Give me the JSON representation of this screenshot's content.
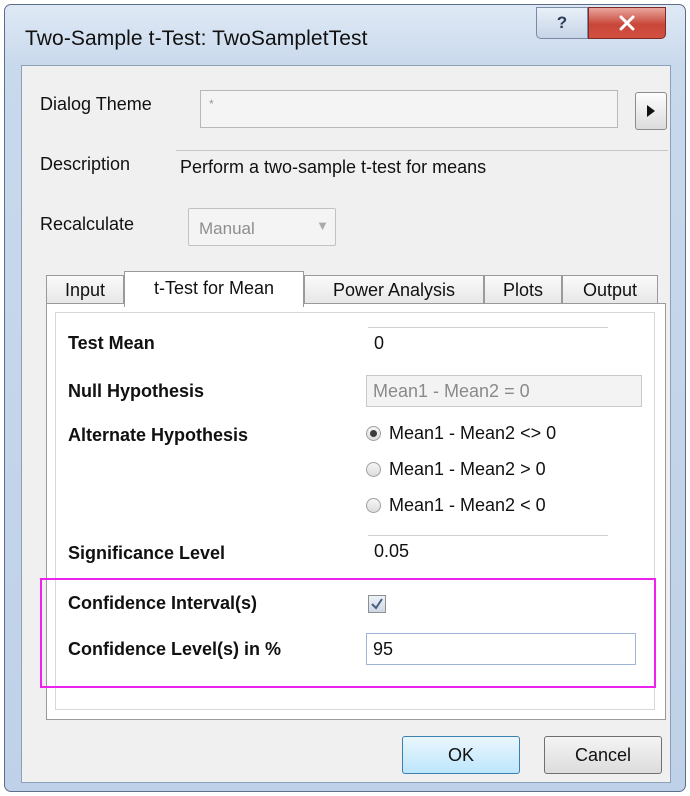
{
  "window": {
    "title": "Two-Sample t-Test: TwoSampletTest",
    "help_label": "?",
    "close_icon": "close-icon"
  },
  "dialog_theme": {
    "label": "Dialog Theme",
    "value": "*"
  },
  "description": {
    "label": "Description",
    "value": "Perform a two-sample t-test for means"
  },
  "recalculate": {
    "label": "Recalculate",
    "value": "Manual"
  },
  "tabs": [
    {
      "label": "Input"
    },
    {
      "label": "t-Test for Mean"
    },
    {
      "label": "Power Analysis"
    },
    {
      "label": "Plots"
    },
    {
      "label": "Output"
    }
  ],
  "active_tab": "t-Test for Mean",
  "params": {
    "test_mean": {
      "label": "Test Mean",
      "value": "0"
    },
    "null_hypothesis": {
      "label": "Null Hypothesis",
      "value": "Mean1 - Mean2 = 0"
    },
    "alternate_hypothesis": {
      "label": "Alternate Hypothesis",
      "options": [
        "Mean1 - Mean2 <> 0",
        "Mean1 - Mean2 > 0",
        "Mean1 - Mean2 < 0"
      ],
      "selected": "Mean1 - Mean2 <> 0"
    },
    "significance_level": {
      "label": "Significance Level",
      "value": "0.05"
    },
    "confidence_intervals": {
      "label": "Confidence Interval(s)",
      "checked": true
    },
    "confidence_level": {
      "label": "Confidence Level(s) in %",
      "value": "95"
    }
  },
  "buttons": {
    "ok": "OK",
    "cancel": "Cancel"
  },
  "colors": {
    "highlight": "#ee22ee",
    "close": "#c8473a"
  }
}
